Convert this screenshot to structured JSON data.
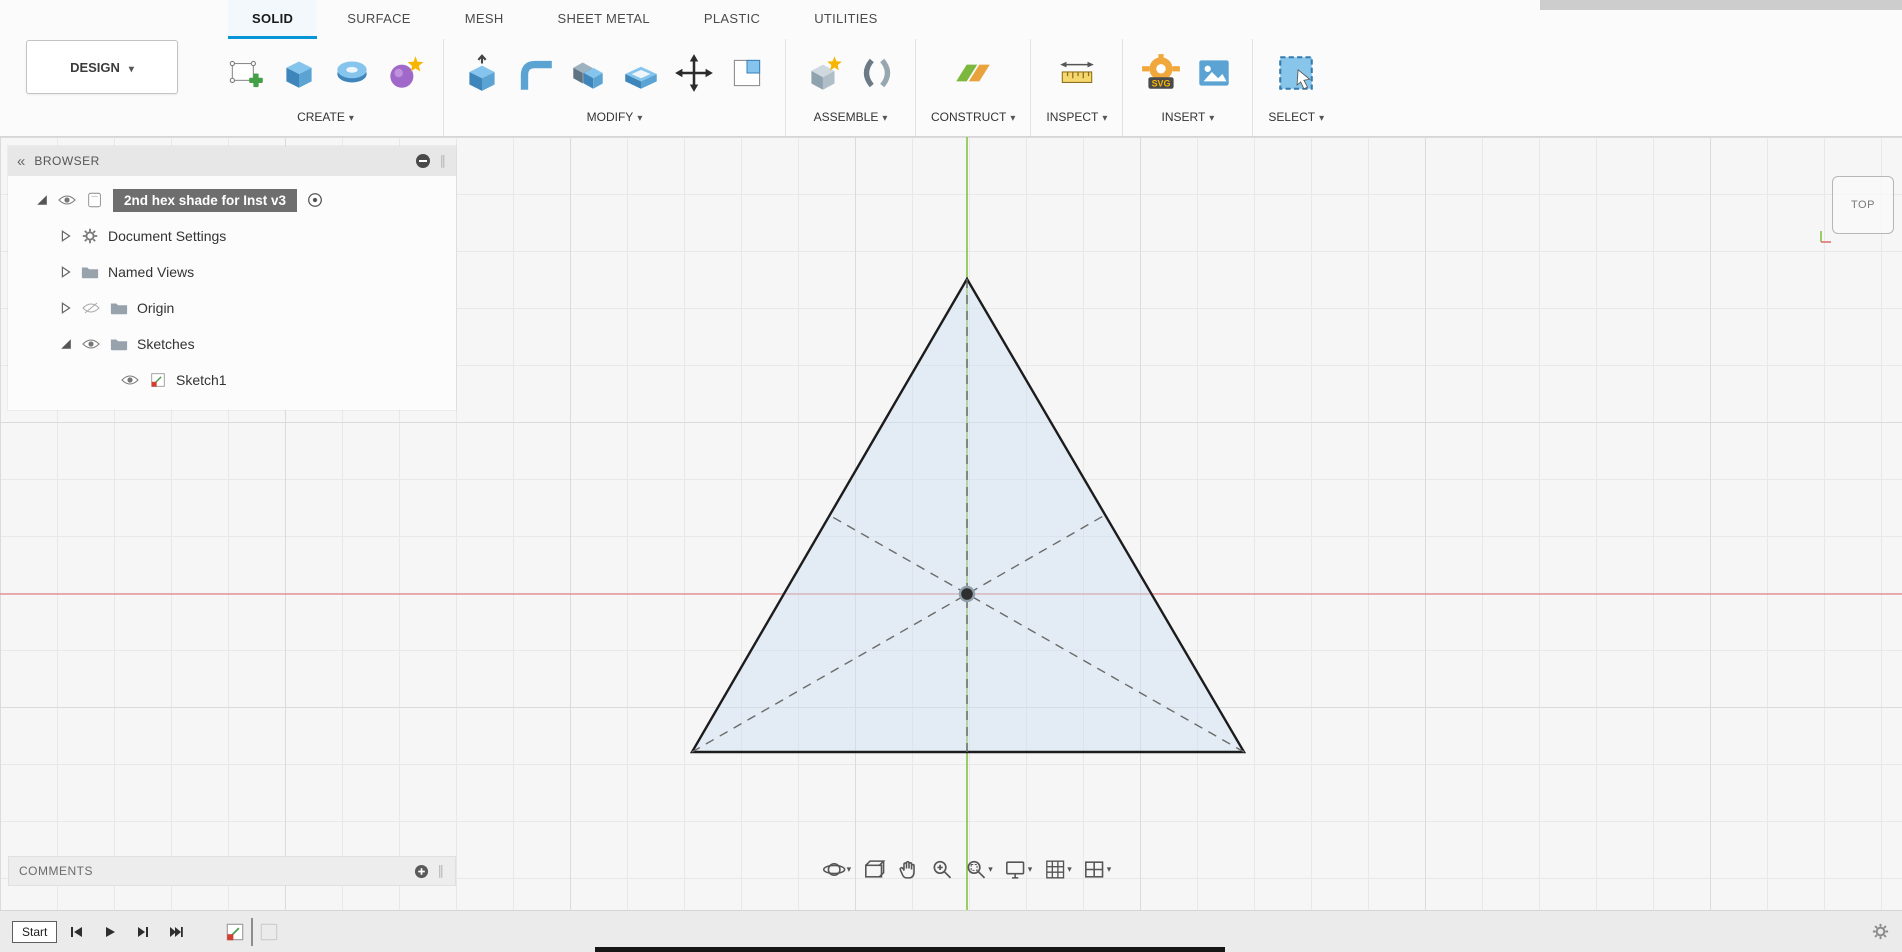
{
  "app": {
    "design_menu": "DESIGN"
  },
  "tabs": [
    {
      "label": "SOLID",
      "active": true
    },
    {
      "label": "SURFACE",
      "active": false
    },
    {
      "label": "MESH",
      "active": false
    },
    {
      "label": "SHEET METAL",
      "active": false
    },
    {
      "label": "PLASTIC",
      "active": false
    },
    {
      "label": "UTILITIES",
      "active": false
    }
  ],
  "toolbar": {
    "groups": [
      {
        "label": "CREATE"
      },
      {
        "label": "MODIFY"
      },
      {
        "label": "ASSEMBLE"
      },
      {
        "label": "CONSTRUCT"
      },
      {
        "label": "INSPECT"
      },
      {
        "label": "INSERT"
      },
      {
        "label": "SELECT"
      }
    ],
    "insert_svg_badge": "SVG"
  },
  "browser": {
    "title": "BROWSER",
    "root_label": "2nd hex shade for Inst v3",
    "items": [
      {
        "label": "Document Settings"
      },
      {
        "label": "Named Views"
      },
      {
        "label": "Origin"
      },
      {
        "label": "Sketches"
      },
      {
        "label": "Sketch1"
      }
    ]
  },
  "viewcube": {
    "label": "TOP"
  },
  "comments": {
    "title": "COMMENTS"
  },
  "timeline": {
    "start_label": "Start"
  },
  "colors": {
    "accent": "#0696d7",
    "axis_x_red": "#e07373",
    "axis_y_green": "#84c341",
    "selection_bg": "#6e6e6e",
    "sketch_fill": "#cbe0f1",
    "sketch_stroke": "#1c1c1c"
  }
}
